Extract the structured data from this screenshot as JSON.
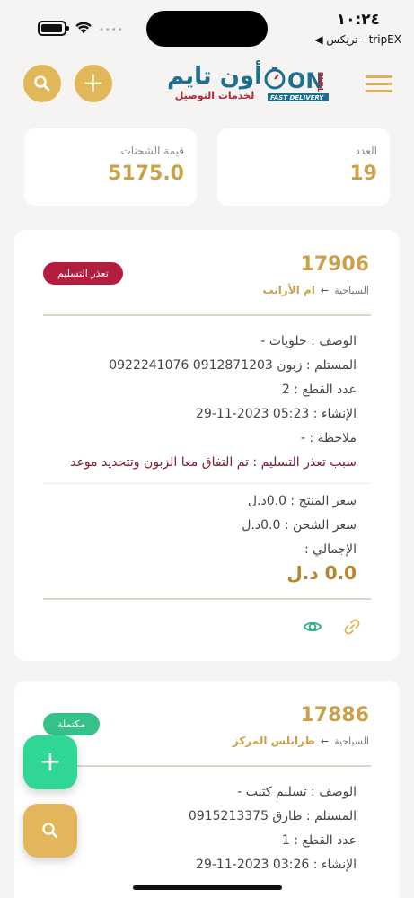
{
  "status_bar": {
    "time": "١٠:٢٤",
    "carrier": "tripEX - تريكس ◀",
    "battery_icon": "battery-icon",
    "wifi_icon": "wifi-icon"
  },
  "header": {
    "logo_ar": "أون تايم",
    "logo_sub": "لخدمات التوصيل",
    "logo_on": "ON",
    "logo_time": "TIME",
    "logo_fast": "FAST DELIVERY",
    "search_icon": "search-icon",
    "add_icon": "plus-icon",
    "menu_icon": "menu-icon"
  },
  "stats": {
    "count_label": "العدد",
    "count_value": "19",
    "value_label": "قيمة الشحنات",
    "value_value": "5175.0"
  },
  "orders": [
    {
      "number": "17906",
      "from": "السياحية",
      "to": "ام الأرانب",
      "status": "تعذر التسليم",
      "status_color": "#b11e40",
      "description": "الوصف : حلويات -",
      "recipient": "المستلم : زبون 0912871203 0922241076",
      "pieces": "عدد القطع : 2",
      "created": "الإنشاء : 05:23 2023-11-29",
      "note": "ملاحظة : -",
      "reason": "سبب تعذر التسليم : تم التفاق معا الزبون وتتحديد موعد",
      "product_price": "سعر المنتج : 0.0د.ل",
      "shipping_price": "سعر الشحن : 0.0د.ل",
      "total_label": "الإجمالي :",
      "total": "0.0 د.ل"
    },
    {
      "number": "17886",
      "from": "السياحية",
      "to": "طرابلس المركز",
      "status": "مكتملة",
      "status_color": "#32c28a",
      "description": "الوصف : تسليم كتيب -",
      "recipient": "المستلم : طارق 0915213375",
      "pieces": "عدد القطع : 1",
      "created": "الإنشاء : 03:26 2023-11-29"
    }
  ],
  "colors": {
    "accent": "#e0b85a",
    "gold_text": "#c9a14b",
    "green": "#2fd694",
    "red": "#b11e40"
  }
}
